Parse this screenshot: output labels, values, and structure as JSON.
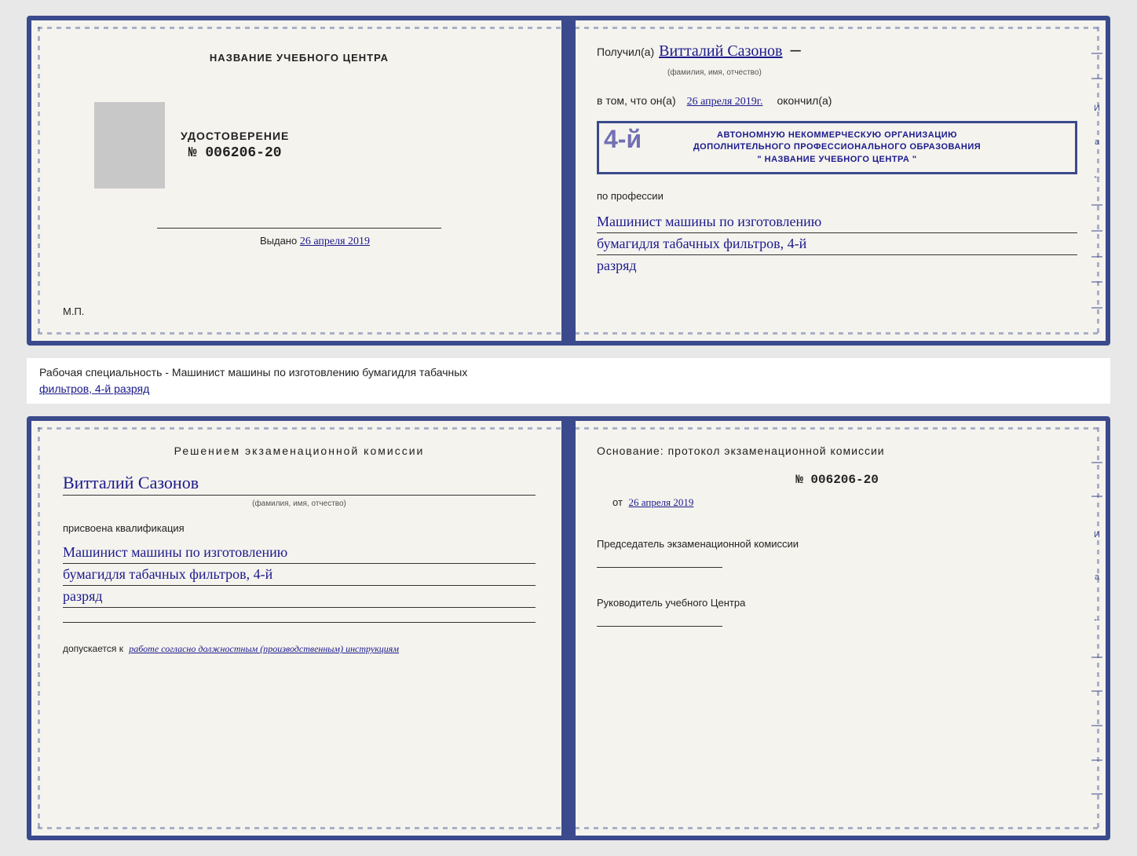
{
  "top_cert": {
    "left": {
      "title": "НАЗВАНИЕ УЧЕБНОГО ЦЕНТРА",
      "udost_label": "УДОСТОВЕРЕНИЕ",
      "udost_num": "№ 006206-20",
      "vydano_label": "Выдано",
      "vydano_date": "26 апреля 2019",
      "mp_label": "М.П."
    },
    "right": {
      "poluchil_label": "Получил(а)",
      "fio_handwritten": "Витталий Сазонов",
      "fio_subtitle": "(фамилия, имя, отчество)",
      "vtom_label": "в том, что он(а)",
      "date_handwritten": "26 апреля 2019г.",
      "okonchil_label": "окончил(а)",
      "stamp_line1": "АВТОНОМНУЮ НЕКОММЕРЧЕСКУЮ ОРГАНИЗАЦИЮ",
      "stamp_line2": "ДОПОЛНИТЕЛЬНОГО ПРОФЕССИОНАЛЬНОГО ОБРАЗОВАНИЯ",
      "stamp_line3": "\" НАЗВАНИЕ УЧЕБНОГО ЦЕНТРА \"",
      "stamp_big_num": "4-й",
      "po_professii_label": "по профессии",
      "profession_line1": "Машинист машины по изготовлению",
      "profession_line2": "бумагидля табачных фильтров, 4-й",
      "profession_line3": "разряд"
    }
  },
  "between": {
    "text_prefix": "Рабочая специальность - Машинист машины по изготовлению бумагидля табачных",
    "text_underlined": "фильтров, 4-й разряд"
  },
  "bottom_cert": {
    "left": {
      "resheniem_title": "Решением  экзаменационной  комиссии",
      "fio_handwritten": "Витталий Сазонов",
      "fio_subtitle": "(фамилия, имя, отчество)",
      "prisvoena_label": "присвоена квалификация",
      "profession_line1": "Машинист машины по изготовлению",
      "profession_line2": "бумагидля табачных фильтров, 4-й",
      "profession_line3": "разряд",
      "dopuskaetsya_label": "допускается к",
      "dopuskaetsya_value": "работе согласно должностным (производственным) инструкциям"
    },
    "right": {
      "osnovanie_label": "Основание: протокол экзаменационной  комиссии",
      "protokol_num": "№  006206-20",
      "ot_label": "от",
      "ot_date": "26 апреля 2019",
      "predsedatel_label": "Председатель экзаменационной комиссии",
      "rukovoditel_label": "Руководитель учебного Центра"
    }
  }
}
